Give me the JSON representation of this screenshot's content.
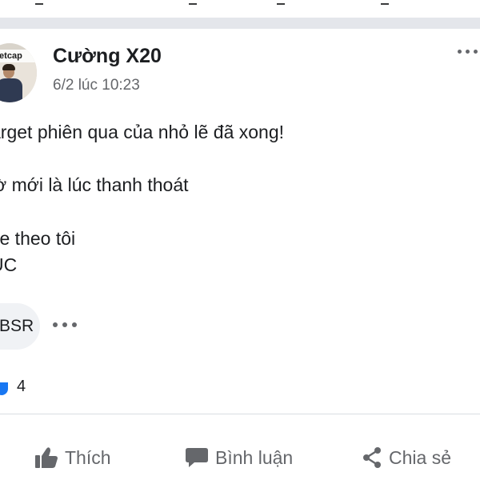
{
  "post": {
    "author": "Cường X20",
    "timestamp": "6/2 lúc 10:23",
    "avatar_sign": "ietcap",
    "lines": [
      "arget phiên qua của nhỏ lẽ đã xong!",
      "iờ mới là lúc thanh thoát",
      "ce theo tôi",
      "ÚC"
    ],
    "tag": "BSR",
    "reaction_count": "4"
  },
  "actions": {
    "like": "Thích",
    "comment": "Bình luận",
    "share": "Chia sẻ"
  },
  "colors": {
    "text": "#1c1e21",
    "secondary": "#65676b",
    "separator": "#e4e6eb",
    "chip": "#f0f2f5",
    "like_blue": "#1877f2"
  }
}
